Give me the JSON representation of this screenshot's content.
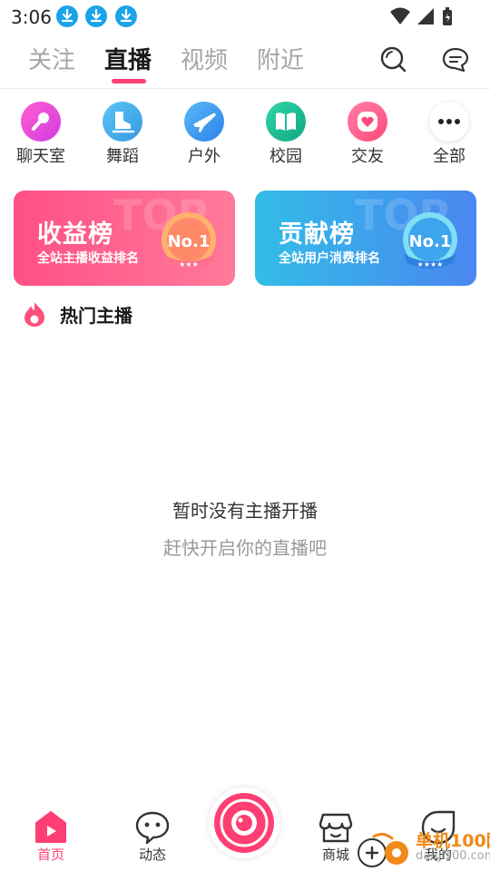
{
  "status_bar": {
    "time": "3:06",
    "download_icons": [
      "download-icon",
      "download-icon",
      "download-icon"
    ],
    "right_icons": [
      "wifi-icon",
      "signal-icon",
      "battery-icon"
    ]
  },
  "top_tabs": {
    "items": [
      "关注",
      "直播",
      "视频",
      "附近"
    ],
    "active": "直播",
    "right_icons": [
      "search-icon",
      "message-icon"
    ]
  },
  "categories": [
    {
      "label": "聊天室",
      "icon": "microphone-icon",
      "color": "#ec3fcf"
    },
    {
      "label": "舞蹈",
      "icon": "skate-icon",
      "color": "#42aee8"
    },
    {
      "label": "户外",
      "icon": "plane-icon",
      "color": "#3a9ef0"
    },
    {
      "label": "校园",
      "icon": "book-icon",
      "color": "#1dbf97"
    },
    {
      "label": "交友",
      "icon": "heart-icon",
      "color": "#fe5c8a"
    },
    {
      "label": "全部",
      "icon": "more-icon",
      "color": "#ffffff"
    }
  ],
  "banners": [
    {
      "title": "收益榜",
      "subtitle": "全站主播收益排名",
      "watermark": "TOP",
      "badge": "No.1",
      "stars": "★★★",
      "color_from": "#ff4f86",
      "color_to": "#ff7a9a"
    },
    {
      "title": "贡献榜",
      "subtitle": "全站用户消费排名",
      "watermark": "TOP",
      "badge": "No.1",
      "stars": "★★★★",
      "color_from": "#32bde8",
      "color_to": "#4a86f0"
    }
  ],
  "hot_section": {
    "title": "热门主播",
    "icon": "flame-icon",
    "accent": "#ff3f73"
  },
  "empty_state": {
    "line1": "暂时没有主播开播",
    "line2": "赶快开启你的直播吧"
  },
  "bottom_nav": {
    "items": [
      {
        "label": "首页",
        "icon": "home-play-icon",
        "active": true
      },
      {
        "label": "动态",
        "icon": "chat-face-icon",
        "active": false
      },
      {
        "label": "商城",
        "icon": "store-icon",
        "active": false
      },
      {
        "label": "我的",
        "icon": "profile-icon",
        "active": false
      }
    ],
    "center_icon": "live-camera-icon"
  },
  "watermark": {
    "line1": "单机100网",
    "line2": "danji100.com"
  },
  "colors": {
    "accent": "#ff3f73",
    "inactive_tab": "#a6a6a6"
  }
}
